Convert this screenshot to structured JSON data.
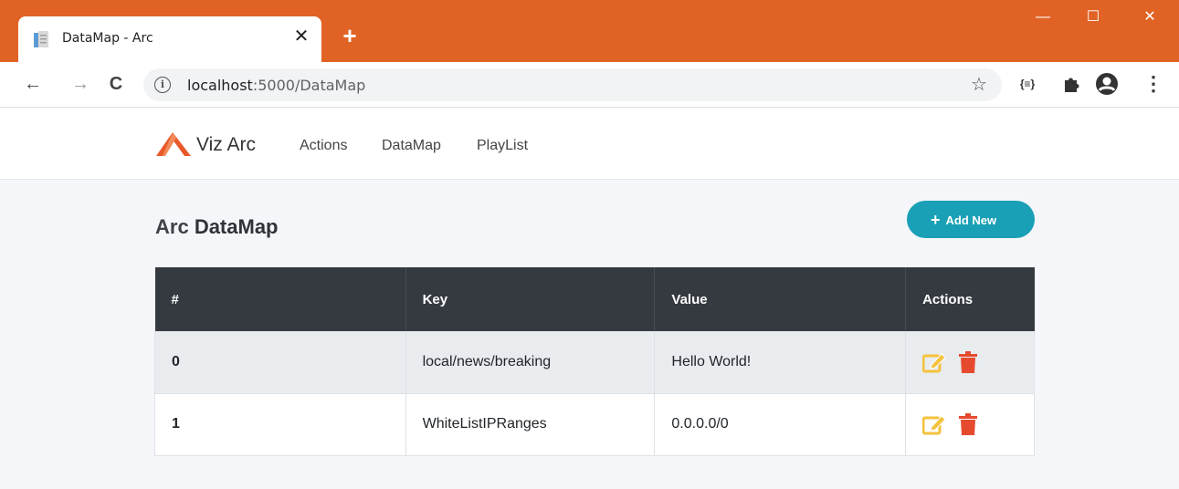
{
  "browser": {
    "tab_title": "DataMap - Arc",
    "close_glyph": "✕",
    "new_tab_glyph": "+",
    "window_controls": {
      "minimize": "—",
      "maximize": "☐",
      "close": "✕"
    },
    "nav": {
      "back": "←",
      "forward": "→",
      "reload": "C"
    },
    "url_host": "localhost",
    "url_rest": ":5000/DataMap",
    "info_glyph": "i",
    "bookmark_glyph": "☆",
    "extensions": {
      "json_ext": "{≡}",
      "menu": "⋮"
    }
  },
  "app": {
    "brand": "Viz Arc",
    "brand_color": "#e85a2a",
    "nav_links": [
      "Actions",
      "DataMap",
      "PlayList"
    ],
    "heading_prefix": "Arc",
    "heading_bold": "DataMap",
    "add_new_label": "Add New",
    "add_new_color": "#1aa0b6"
  },
  "table": {
    "columns": [
      "#",
      "Key",
      "Value",
      "Actions"
    ],
    "rows": [
      {
        "index": "0",
        "key": "local/news/breaking",
        "value": "Hello World!"
      },
      {
        "index": "1",
        "key": "WhiteListIPRanges",
        "value": "0.0.0.0/0"
      }
    ],
    "edit_icon_color": "#f4c23d",
    "delete_icon_color": "#e64a2e"
  },
  "colors": {
    "titlebar": "#e06325",
    "table_header": "#343a40"
  }
}
